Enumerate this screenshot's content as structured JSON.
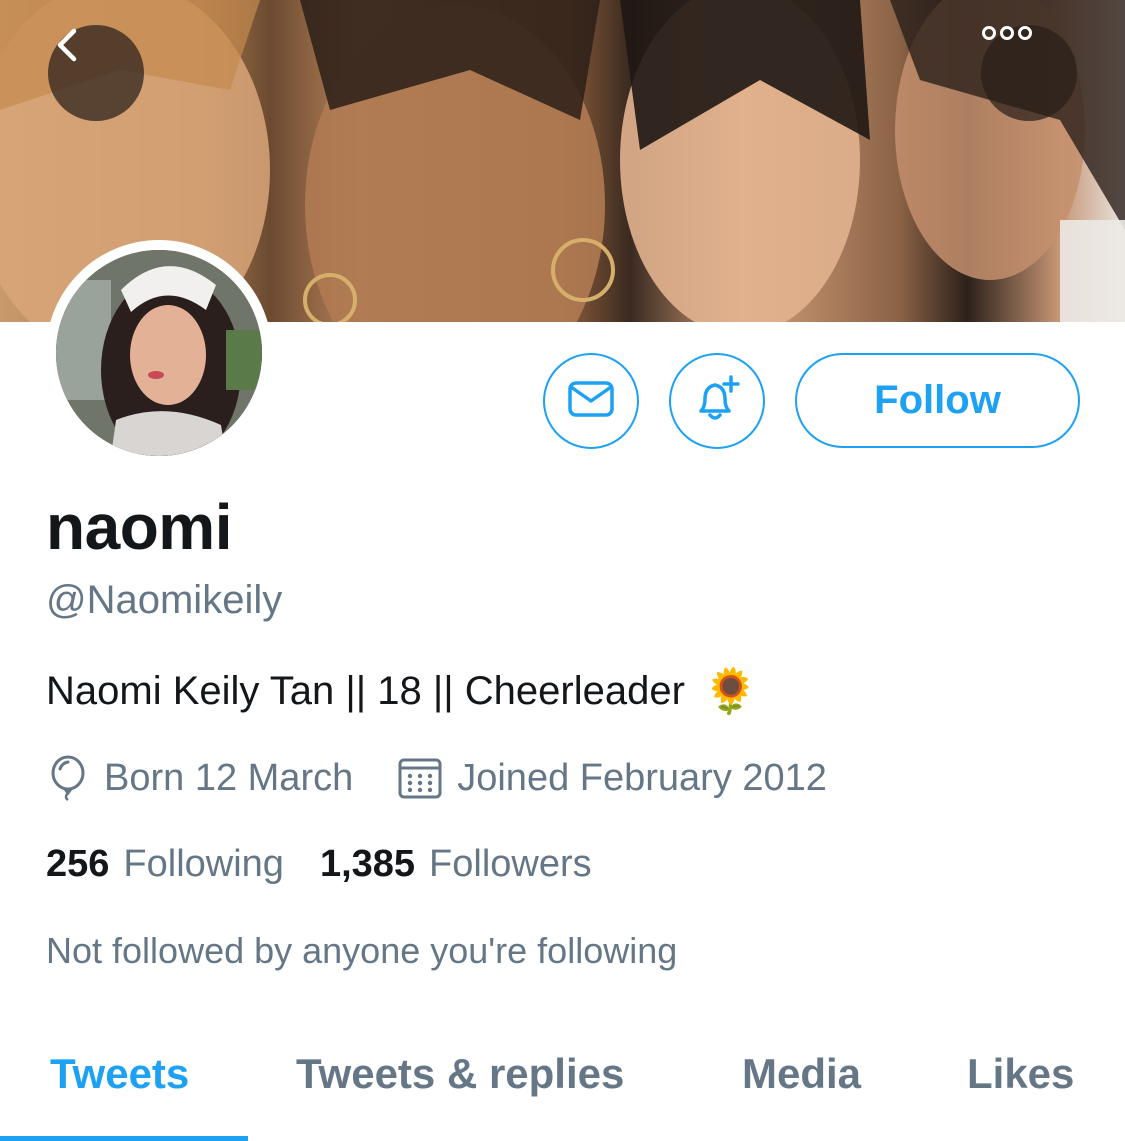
{
  "profile": {
    "display_name": "naomi",
    "handle": "@Naomikeily",
    "bio": "Naomi Keily Tan || 18 || Cheerleader",
    "bio_emoji": "🌻",
    "birthday": "Born 12 March",
    "joined": "Joined February 2012",
    "following_count": "256",
    "following_label": "Following",
    "followers_count": "1,385",
    "followers_label": "Followers",
    "mutual_note": "Not followed by anyone you're following"
  },
  "actions": {
    "follow_label": "Follow"
  },
  "tabs": [
    {
      "label": "Tweets",
      "active": true
    },
    {
      "label": "Tweets & replies",
      "active": false
    },
    {
      "label": "Media",
      "active": false
    },
    {
      "label": "Likes",
      "active": false
    }
  ],
  "icons": {
    "back": "chevron-left-icon",
    "more": "more-dots-icon",
    "dm": "envelope-icon",
    "notify": "bell-plus-icon",
    "birthday": "balloon-icon",
    "joined": "calendar-icon"
  },
  "colors": {
    "accent": "#1da1f2",
    "text_primary": "#14171a",
    "text_secondary": "#657786"
  }
}
